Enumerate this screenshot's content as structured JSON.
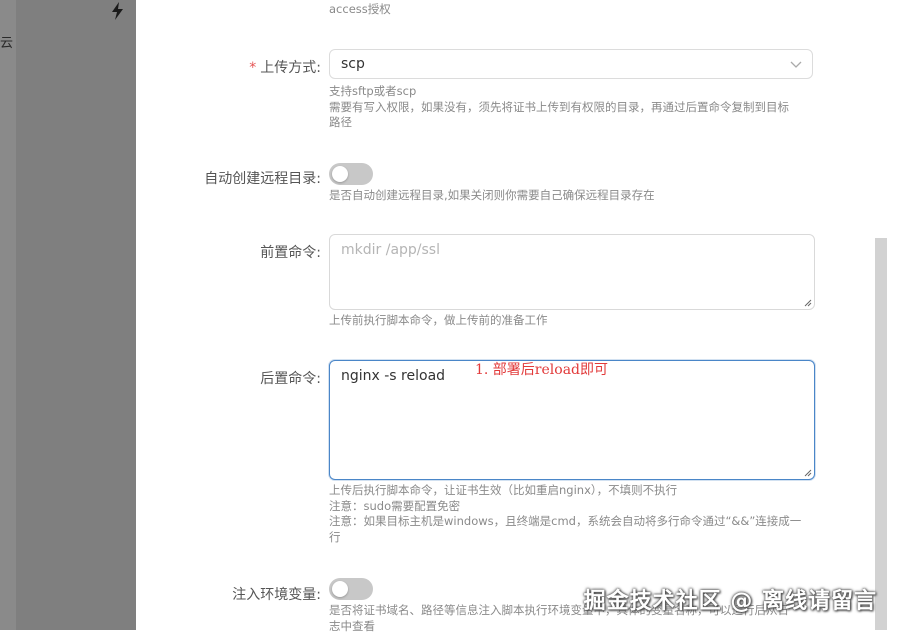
{
  "sidebar": {
    "bolt_icon": "lightning-icon",
    "partial_text": "云"
  },
  "top_hint": "access授权",
  "upload_method": {
    "required_mark": "*",
    "label": "上传方式:",
    "value": "scp",
    "hint_lines": [
      "支持sftp或者scp",
      "需要有写入权限，如果没有，须先将证书上传到有权限的目录，再通过后置命令复制到目标",
      "路径"
    ]
  },
  "auto_create_dir": {
    "label": "自动创建远程目录:",
    "enabled": false,
    "hint": "是否自动创建远程目录,如果关闭则你需要自己确保远程目录存在"
  },
  "pre_command": {
    "label": "前置命令:",
    "placeholder": "mkdir /app/ssl",
    "hint": "上传前执行脚本命令，做上传前的准备工作"
  },
  "post_command": {
    "label": "后置命令:",
    "value": "nginx -s reload",
    "annotation": "1. 部署后reload即可",
    "hint_lines": [
      "上传后执行脚本命令，让证书生效（比如重启nginx），不填则不执行",
      "注意：sudo需要配置免密",
      "注意：如果目标主机是windows，且终端是cmd，系统会自动将多行命令通过“&&”连接成一",
      "行"
    ]
  },
  "inject_env": {
    "label": "注入环境变量:",
    "enabled": false,
    "hint_lines": [
      "是否将证书域名、路径等信息注入脚本执行环境变量中，具体的变量名称，可以运行后从日",
      "志中查看"
    ]
  },
  "watermark": "掘金技术社区 @ 离线请留言",
  "colors": {
    "accent": "#4a86c8",
    "required": "#e55353",
    "annotation": "#e23a3a"
  }
}
